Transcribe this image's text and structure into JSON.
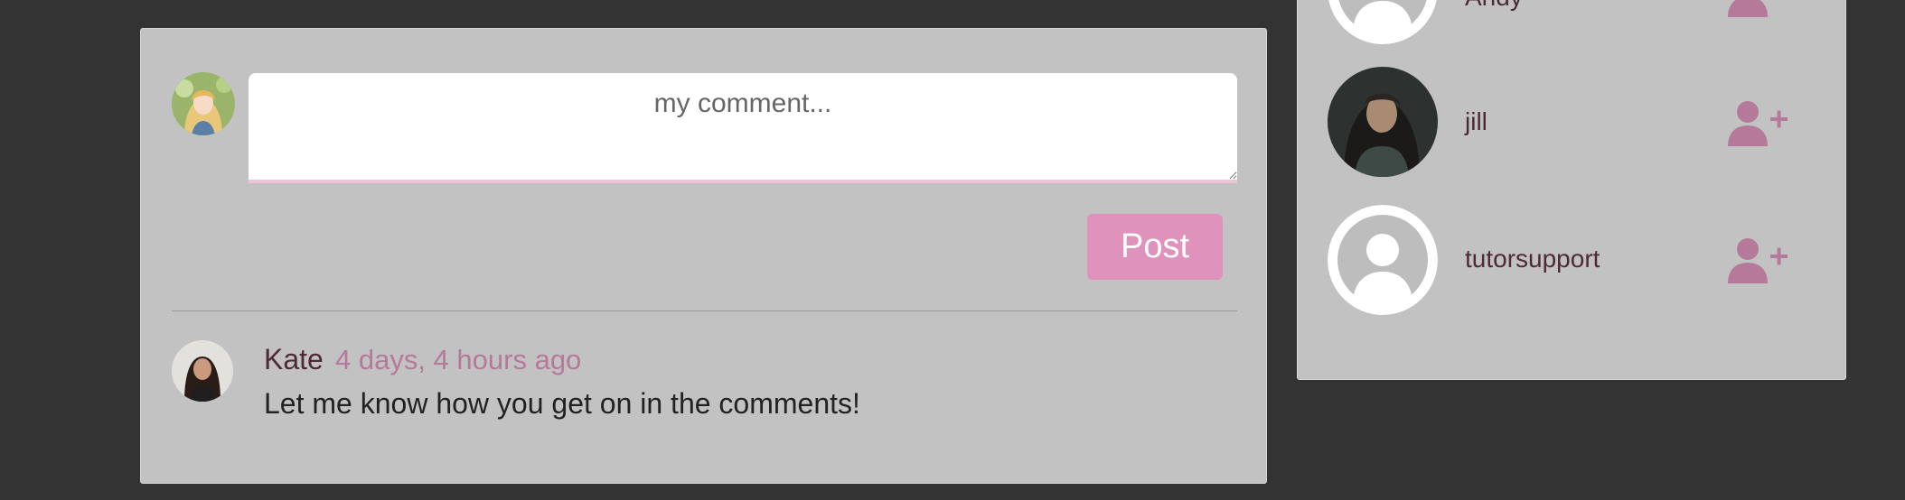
{
  "comment_form": {
    "placeholder": "my comment...",
    "post_label": "Post"
  },
  "comments": [
    {
      "author": "Kate",
      "time": "4 days, 4 hours ago",
      "text": "Let me know how you get on in the comments!"
    }
  ],
  "users": [
    {
      "name": "Andy",
      "avatar": "default-avatar-icon"
    },
    {
      "name": "jill",
      "avatar": "photo"
    },
    {
      "name": "tutorsupport",
      "avatar": "default-avatar-icon"
    }
  ],
  "colors": {
    "page_background": "#333333",
    "panel_background": "#c2c2c2",
    "accent_pink": "#df92bb",
    "follow_icon": "#b57a9a",
    "author_name": "#4e2a38"
  }
}
